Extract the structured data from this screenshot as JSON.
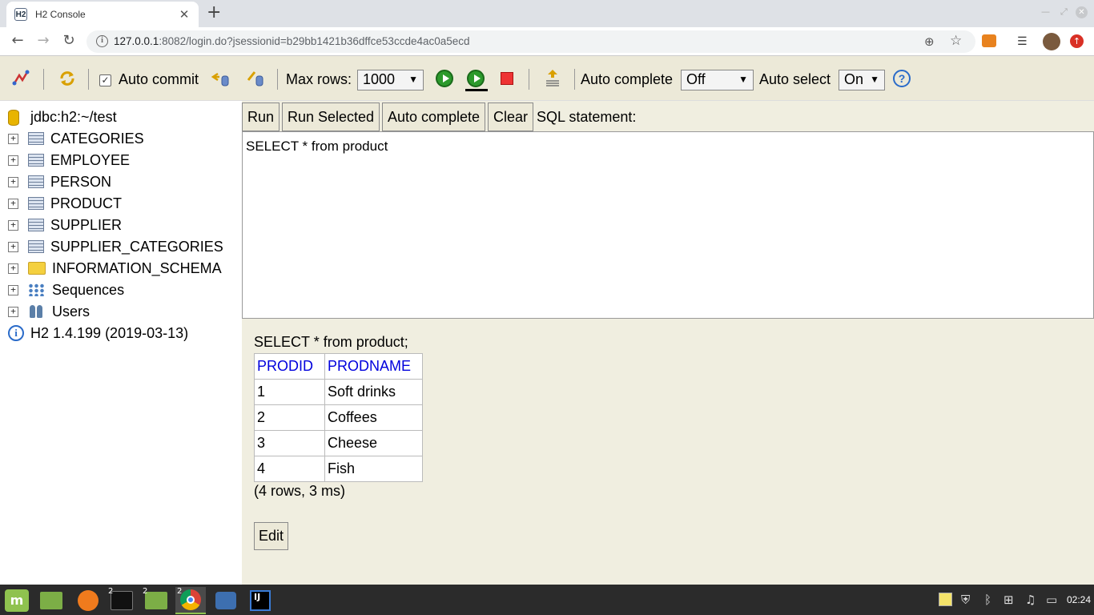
{
  "browser": {
    "tab_title": "H2 Console",
    "tab_favicon": "H2",
    "url_host": "127.0.0.1",
    "url_rest": ":8082/login.do?jsessionid=b29bb1421b36dffce53ccde4ac0a5ecd"
  },
  "toolbar": {
    "auto_commit_label": "Auto commit",
    "auto_commit_checked": true,
    "max_rows_label": "Max rows:",
    "max_rows_value": "1000",
    "auto_complete_label": "Auto complete",
    "auto_complete_value": "Off",
    "auto_select_label": "Auto select",
    "auto_select_value": "On",
    "icons": [
      "disconnect-icon",
      "refresh-icon",
      "rollback-icon",
      "commit-icon",
      "run-icon",
      "run-selected-icon",
      "stop-icon",
      "history-icon",
      "help-icon"
    ]
  },
  "tree": {
    "root": "jdbc:h2:~/test",
    "items": [
      {
        "label": "CATEGORIES",
        "icon": "table-icon"
      },
      {
        "label": "EMPLOYEE",
        "icon": "table-icon"
      },
      {
        "label": "PERSON",
        "icon": "table-icon"
      },
      {
        "label": "PRODUCT",
        "icon": "table-icon"
      },
      {
        "label": "SUPPLIER",
        "icon": "table-icon"
      },
      {
        "label": "SUPPLIER_CATEGORIES",
        "icon": "table-icon"
      },
      {
        "label": "INFORMATION_SCHEMA",
        "icon": "folder-icon"
      },
      {
        "label": "Sequences",
        "icon": "sequences-icon"
      },
      {
        "label": "Users",
        "icon": "users-icon"
      }
    ],
    "version": "H2 1.4.199 (2019-03-13)"
  },
  "main": {
    "buttons": {
      "run": "Run",
      "run_selected": "Run Selected",
      "auto_complete": "Auto complete",
      "clear": "Clear"
    },
    "sql_label": "SQL statement:",
    "sql_text": "SELECT * from product",
    "result": {
      "query": "SELECT * from product;",
      "columns": [
        "PRODID",
        "PRODNAME"
      ],
      "rows": [
        [
          "1",
          "Soft drinks"
        ],
        [
          "2",
          "Coffees"
        ],
        [
          "3",
          "Cheese"
        ],
        [
          "4",
          "Fish"
        ]
      ],
      "info": "(4 rows, 3 ms)",
      "edit_label": "Edit"
    }
  },
  "taskbar": {
    "clock": "02:24",
    "badge_terminal": "2",
    "badge_files": "2",
    "badge_chrome": "2"
  }
}
